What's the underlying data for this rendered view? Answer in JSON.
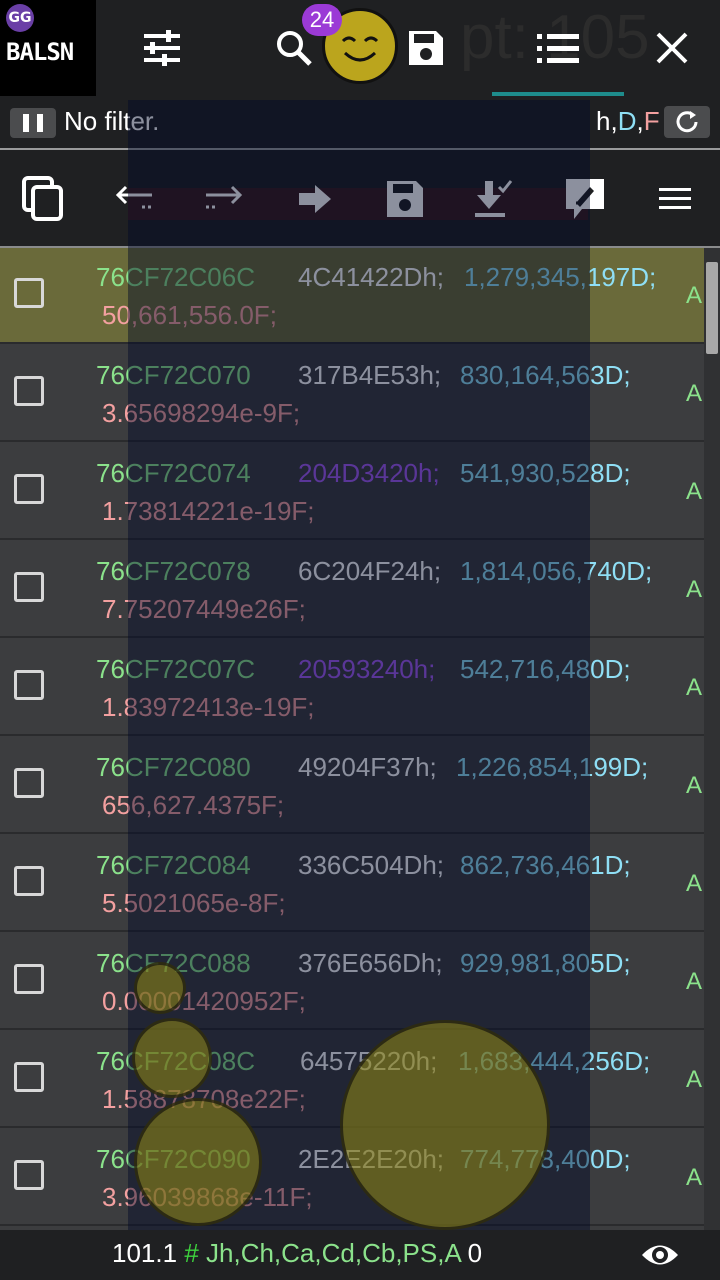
{
  "app": {
    "logo_text": "BALSN",
    "logo_badge": "GG",
    "notif_count": "24",
    "pointer_text": "pt: 105"
  },
  "filter": {
    "text": "No filter.",
    "type_h": "h",
    "type_d": "D",
    "type_f": "F",
    "comma": ","
  },
  "rows": [
    {
      "address": "76CF72C06C",
      "hex": "4C41422Dh;",
      "dec": "1,279,345,197D;",
      "float": "50,661,556.0F;",
      "tag": "A",
      "selected": true
    },
    {
      "address": "76CF72C070",
      "hex": "317B4E53h;",
      "dec": "830,164,563D;",
      "float": "3.65698294e-9F;",
      "tag": "A"
    },
    {
      "address": "76CF72C074",
      "hex": "204D3420h;",
      "dec": "541,930,528D;",
      "float": "1.73814221e-19F;",
      "tag": "A"
    },
    {
      "address": "76CF72C078",
      "hex": "6C204F24h;",
      "dec": "1,814,056,740D;",
      "float": "7.75207449e26F;",
      "tag": "A"
    },
    {
      "address": "76CF72C07C",
      "hex": "20593240h;",
      "dec": "542,716,480D;",
      "float": "1.83972413e-19F;",
      "tag": "A"
    },
    {
      "address": "76CF72C080",
      "hex": "49204F37h;",
      "dec": "1,226,854,199D;",
      "float": "656,627.4375F;",
      "tag": "A"
    },
    {
      "address": "76CF72C084",
      "hex": "336C504Dh;",
      "dec": "862,736,461D;",
      "float": "5.5021065e-8F;",
      "tag": "A"
    },
    {
      "address": "76CF72C088",
      "hex": "376E656Dh;",
      "dec": "929,981,805D;",
      "float": "0.00001420952F;",
      "tag": "A"
    },
    {
      "address": "76CF72C08C",
      "hex": "64575220h;",
      "dec": "1,683,444,256D;",
      "float": "1.58878708e22F;",
      "tag": "A"
    },
    {
      "address": "76CF72C090",
      "hex": "2E2E2E20h;",
      "dec": "774,778,400D;",
      "float": "3.96039868e-11F;",
      "tag": "A"
    }
  ],
  "status": {
    "value": "101.1",
    "hash": "#",
    "regions": "Jh,Ch,Ca,Cd,Cb,PS,A",
    "count": "0"
  },
  "colors": {
    "address": "#8be28b",
    "hex": "#ffffff",
    "hex_alt": "#a55cf5",
    "dec": "#8fdff5",
    "float": "#f3a0a0",
    "selected_row": "#6a6a3a",
    "accent_tab": "#1e8c8c",
    "badge": "#9b3ad6"
  }
}
